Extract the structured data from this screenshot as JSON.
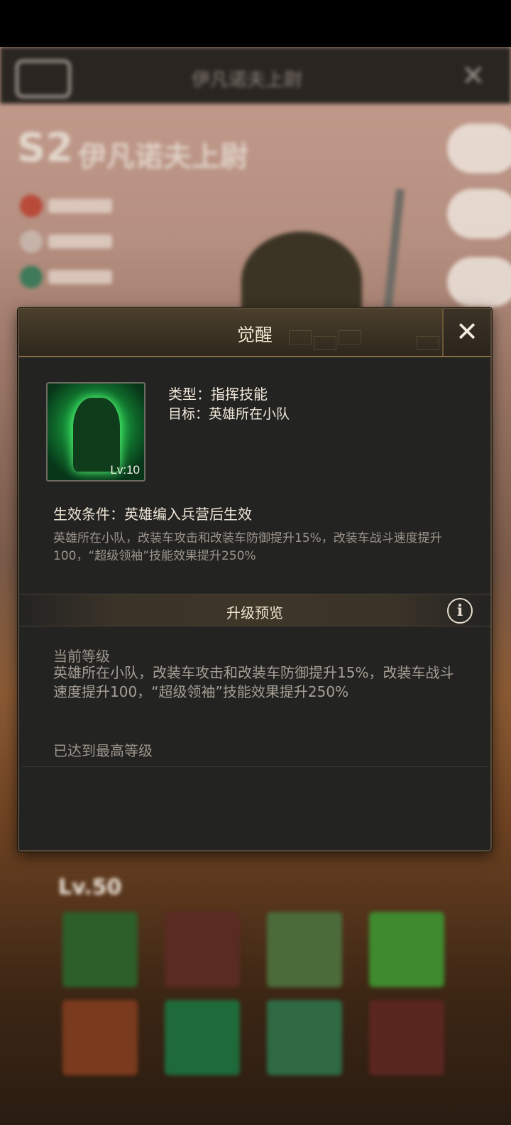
{
  "background": {
    "header_title": "伊凡诺夫上尉",
    "hero_tier": "S2",
    "hero_name": "伊凡诺夫上尉",
    "level": "Lv.50"
  },
  "dialog": {
    "title": "觉醒",
    "close_icon": "✕",
    "skill": {
      "icon": "green-soldier-skill-icon",
      "level": "Lv:10",
      "type_line": "类型：指挥技能",
      "target_line": "目标：英雄所在小队"
    },
    "condition": {
      "title": "生效条件：英雄编入兵营后生效",
      "description": "英雄所在小队，改装车攻击和改装车防御提升15%，改装车战斗速度提升100，“超级领袖”技能效果提升250%"
    },
    "upgrade_preview": {
      "title": "升级预览",
      "info_icon": "i",
      "current_label": "当前等级",
      "current_desc": "英雄所在小队，改装车攻击和改装车防御提升15%，改装车战斗速度提升100，“超级领袖”技能效果提升250%",
      "max_level_text": "已达到最高等级"
    }
  },
  "colors": {
    "panel_bg": "#232322",
    "header_gold": "#8b6f43",
    "text_light": "#efe7d8",
    "text_muted": "#9b948a"
  }
}
